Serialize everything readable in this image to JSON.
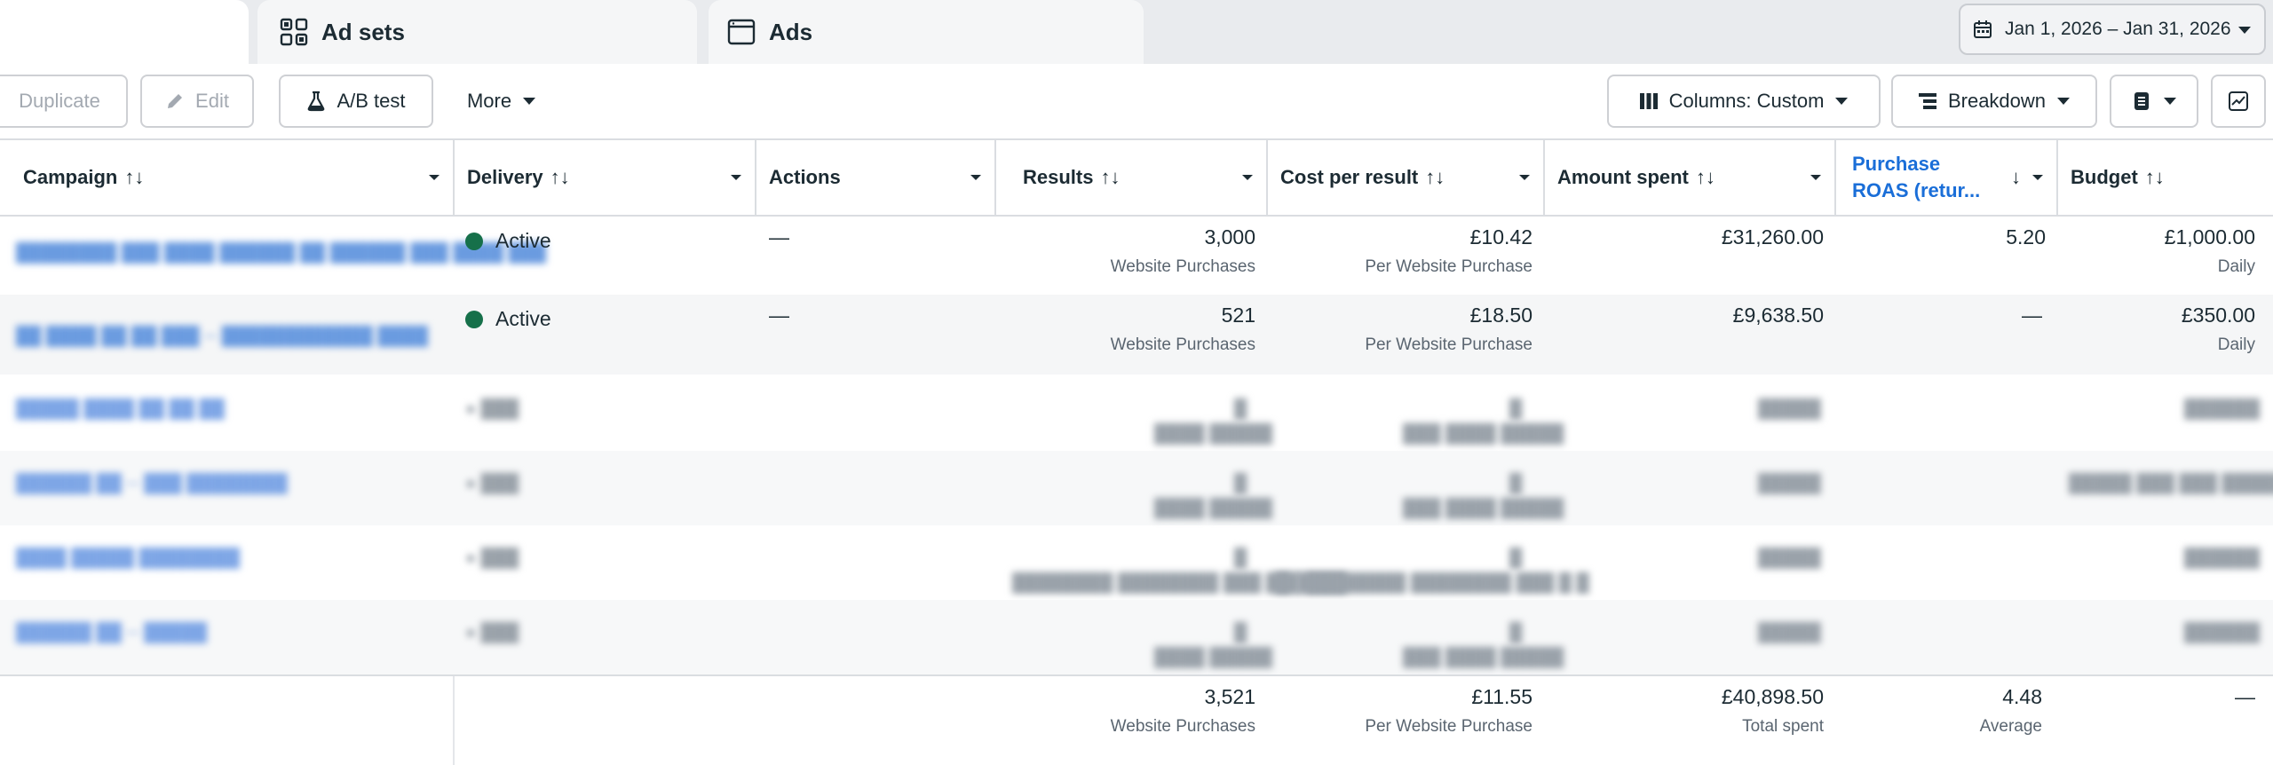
{
  "tabs": {
    "adsets_label": "Ad sets",
    "ads_label": "Ads"
  },
  "date_range": "Jan 1, 2026 – Jan 31, 2026",
  "toolbar": {
    "duplicate_label": "Duplicate",
    "edit_label": "Edit",
    "ab_test_label": "A/B test",
    "more_label": "More",
    "columns_label": "Columns: Custom",
    "breakdown_label": "Breakdown"
  },
  "columns": {
    "campaign": "Campaign",
    "delivery": "Delivery",
    "actions": "Actions",
    "results": "Results",
    "cost_per_result": "Cost per result",
    "amount_spent": "Amount spent",
    "purchase_roas_line1": "Purchase",
    "purchase_roas_line2": "ROAS (retur...",
    "budget": "Budget",
    "sort_glyph": "↑↓",
    "sort_desc_glyph": "↓"
  },
  "rows": [
    {
      "delivery": "Active",
      "actions": "—",
      "results": "3,000",
      "results_sub": "Website Purchases",
      "cost_per_result": "£10.42",
      "cost_sub": "Per Website Purchase",
      "amount_spent": "£31,260.00",
      "roas": "5.20",
      "budget": "£1,000.00",
      "budget_sub": "Daily"
    },
    {
      "delivery": "Active",
      "actions": "—",
      "results": "521",
      "results_sub": "Website Purchases",
      "cost_per_result": "£18.50",
      "cost_sub": "Per Website Purchase",
      "amount_spent": "£9,638.50",
      "roas": "—",
      "budget": "£350.00",
      "budget_sub": "Daily"
    }
  ],
  "totals": {
    "results": "3,521",
    "results_sub": "Website Purchases",
    "cost_per_result": "£11.55",
    "cost_sub": "Per Website Purchase",
    "amount_spent": "£40,898.50",
    "amount_sub": "Total spent",
    "roas": "4.48",
    "roas_sub": "Average",
    "budget": "—"
  },
  "colors": {
    "active_dot": "#16704a",
    "link_blue": "#1a6ed8"
  }
}
